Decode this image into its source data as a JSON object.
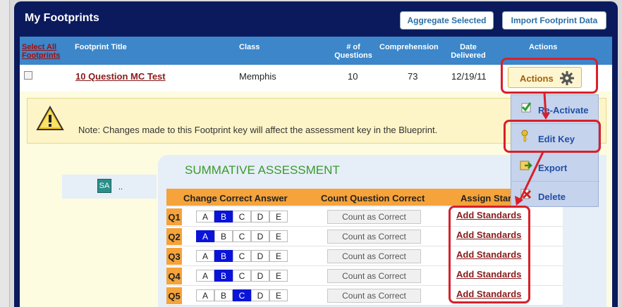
{
  "header": {
    "title": "My Footprints",
    "aggregate_label": "Aggregate Selected",
    "import_label": "Import Footprint Data"
  },
  "columns": {
    "select_all": "Select All Footprints",
    "title": "Footprint Title",
    "class": "Class",
    "num_questions": "# of Questions",
    "comprehension": "Comprehension",
    "date_delivered": "Date Delivered",
    "actions": "Actions"
  },
  "footprint": {
    "title": "10 Question MC Test",
    "class": "Memphis",
    "num_questions": "10",
    "comprehension": "73",
    "date_delivered": "12/19/11",
    "actions_label": "Actions"
  },
  "note": "Note: Changes made to this Footprint key will affect the assessment key in the Blueprint.",
  "assessment": {
    "badge": "SA",
    "dots": "..",
    "title": "SUMMATIVE ASSESSMENT",
    "col_change": "Change Correct Answer",
    "col_count": "Count Question Correct",
    "col_assign": "Assign Star",
    "count_label": "Count as Correct",
    "add_label": "Add Standards",
    "questions": [
      {
        "label": "Q1",
        "selected": "B"
      },
      {
        "label": "Q2",
        "selected": "A"
      },
      {
        "label": "Q3",
        "selected": "B"
      },
      {
        "label": "Q4",
        "selected": "B"
      },
      {
        "label": "Q5",
        "selected": "C"
      }
    ],
    "choices": [
      "A",
      "B",
      "C",
      "D",
      "E"
    ]
  },
  "menu": {
    "reactivate": "Re-Activate",
    "edit_key": "Edit Key",
    "export": "Export",
    "delete": "Delete"
  },
  "colors": {
    "frame": "#0a1a5c",
    "header_blue": "#3c86c9",
    "orange": "#f5a33a",
    "selected_choice": "#0a14d8",
    "highlight_red": "#d8202a"
  }
}
